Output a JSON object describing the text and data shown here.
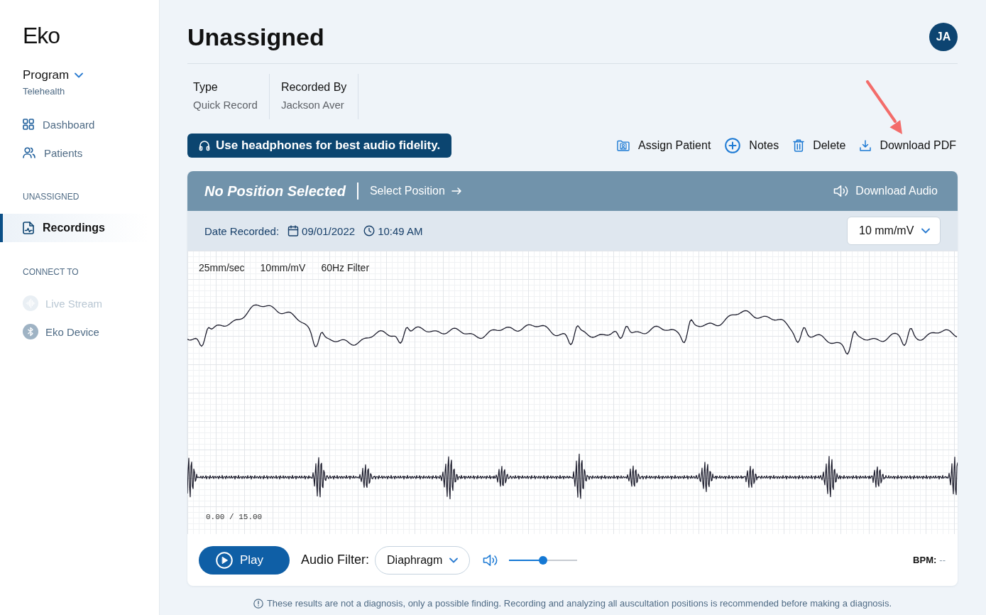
{
  "sidebar": {
    "logo": "Eko",
    "program": {
      "label": "Program",
      "value": "Telehealth"
    },
    "groups": [
      {
        "items": [
          {
            "kind": "dashboard",
            "label": "Dashboard",
            "selected": false,
            "disabled": false
          },
          {
            "kind": "patients",
            "label": "Patients",
            "selected": false,
            "disabled": false
          }
        ]
      },
      {
        "heading": "UNASSIGNED",
        "items": [
          {
            "kind": "recordings",
            "label": "Recordings",
            "selected": true,
            "disabled": false
          }
        ]
      },
      {
        "heading": "CONNECT TO",
        "items": [
          {
            "kind": "stream",
            "label": "Live Stream",
            "selected": false,
            "disabled": true
          },
          {
            "kind": "device",
            "label": "Eko Device",
            "selected": false,
            "disabled": false
          }
        ]
      }
    ]
  },
  "header": {
    "title": "Unassigned",
    "avatar": "JA"
  },
  "details": [
    {
      "label": "Type",
      "value": "Quick Record"
    },
    {
      "label": "Recorded By",
      "value": "Jackson Aver"
    }
  ],
  "notice": "Use headphones for best audio fidelity.",
  "actions": [
    {
      "kind": "assign",
      "label": "Assign Patient"
    },
    {
      "kind": "notes",
      "label": "Notes"
    },
    {
      "kind": "delete",
      "label": "Delete"
    },
    {
      "kind": "download",
      "label": "Download PDF"
    }
  ],
  "recording": {
    "position": "No Position Selected",
    "select_position": "Select Position",
    "download_audio": "Download Audio",
    "date_label": "Date Recorded:",
    "date": "09/01/2022",
    "time": "10:49 AM",
    "scale_select": "10 mm/mV",
    "trace_labels": [
      "25mm/sec",
      "10mm/mV",
      "60Hz Filter"
    ],
    "timer": "0.00 / 15.00",
    "play": "Play",
    "audio_filter_label": "Audio Filter:",
    "audio_filter": "Diaphragm",
    "volume": {
      "level": 0.5
    },
    "bpm_label": "BPM:",
    "bpm_value": "--"
  },
  "disclaimer": "These results are not a diagnosis, only a possible finding. Recording and analyzing all auscultation positions is recommended before making a diagnosis."
}
